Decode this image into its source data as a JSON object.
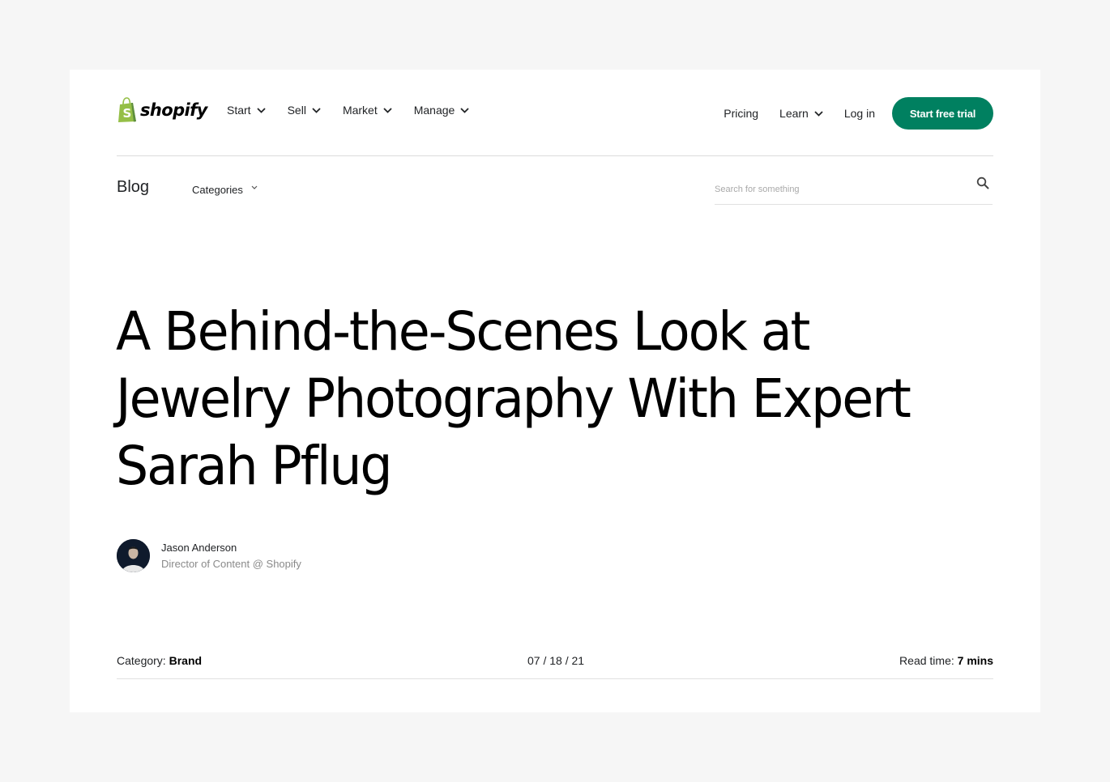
{
  "brand": {
    "name": "shopify",
    "logo_icon": "shopping-bag-icon",
    "accent_color": "#008060",
    "logo_color": "#95bf47"
  },
  "top_nav": {
    "primary": [
      {
        "label": "Start",
        "icon": "chevron-down-icon"
      },
      {
        "label": "Sell",
        "icon": "chevron-down-icon"
      },
      {
        "label": "Market",
        "icon": "chevron-down-icon"
      },
      {
        "label": "Manage",
        "icon": "chevron-down-icon"
      }
    ],
    "secondary": [
      {
        "label": "Pricing"
      },
      {
        "label": "Learn",
        "icon": "chevron-down-icon"
      },
      {
        "label": "Log in"
      }
    ],
    "cta_label": "Start free trial"
  },
  "blog_nav": {
    "title": "Blog",
    "categories_label": "Categories",
    "search": {
      "placeholder": "Search for something",
      "value": "",
      "icon": "search-icon"
    }
  },
  "article": {
    "title": "A Behind-the-Scenes Look at Jewelry Photography With Expert Sarah Pflug",
    "author": {
      "name": "Jason Anderson",
      "role": "Director of Content @ Shopify"
    },
    "meta": {
      "category_label": "Category:",
      "category_value": "Brand",
      "date": "07 / 18 / 21",
      "read_time_label": "Read time:",
      "read_time_value": "7 mins"
    }
  }
}
